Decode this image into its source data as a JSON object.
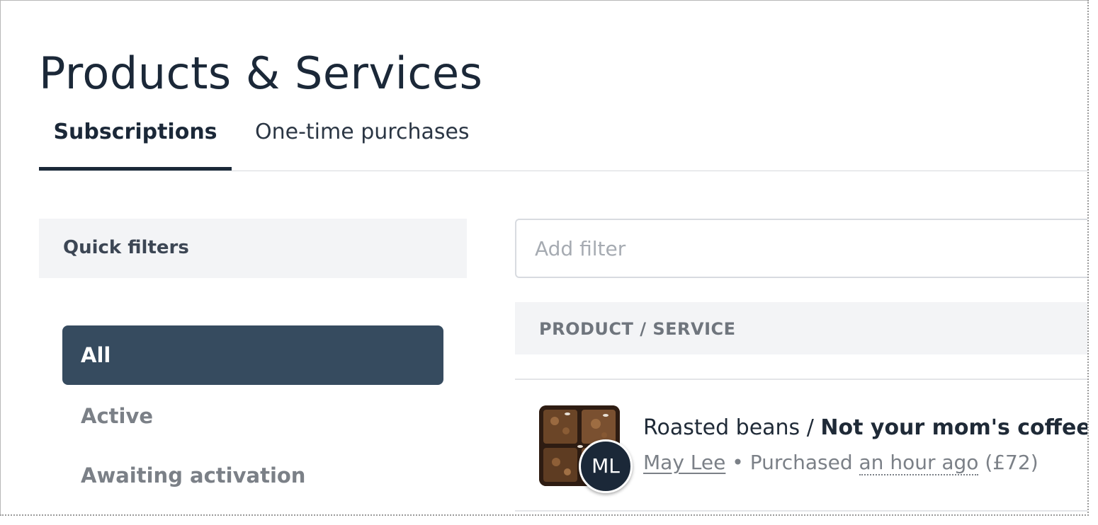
{
  "page": {
    "title": "Products & Services"
  },
  "tabs": [
    {
      "label": "Subscriptions",
      "active": true
    },
    {
      "label": "One-time purchases",
      "active": false
    }
  ],
  "quick_filters": {
    "heading": "Quick filters",
    "items": [
      {
        "label": "All",
        "selected": true
      },
      {
        "label": "Active",
        "selected": false
      },
      {
        "label": "Awaiting activation",
        "selected": false
      }
    ]
  },
  "filter_input": {
    "placeholder": "Add filter",
    "value": ""
  },
  "table": {
    "header": "PRODUCT / SERVICE",
    "rows": [
      {
        "category": "Roasted beans",
        "separator": " / ",
        "product": "Not your mom's coffee",
        "customer_initials": "ML",
        "customer_name": "May Lee",
        "bullet": " • ",
        "purchased_label": "Purchased ",
        "time_ago": "an hour ago",
        "price": " (£72)"
      }
    ]
  },
  "colors": {
    "accent_dark": "#1b2838",
    "selected_filter_bg": "#364b5f",
    "panel_bg": "#f3f4f6",
    "muted_text": "#7b8087"
  }
}
